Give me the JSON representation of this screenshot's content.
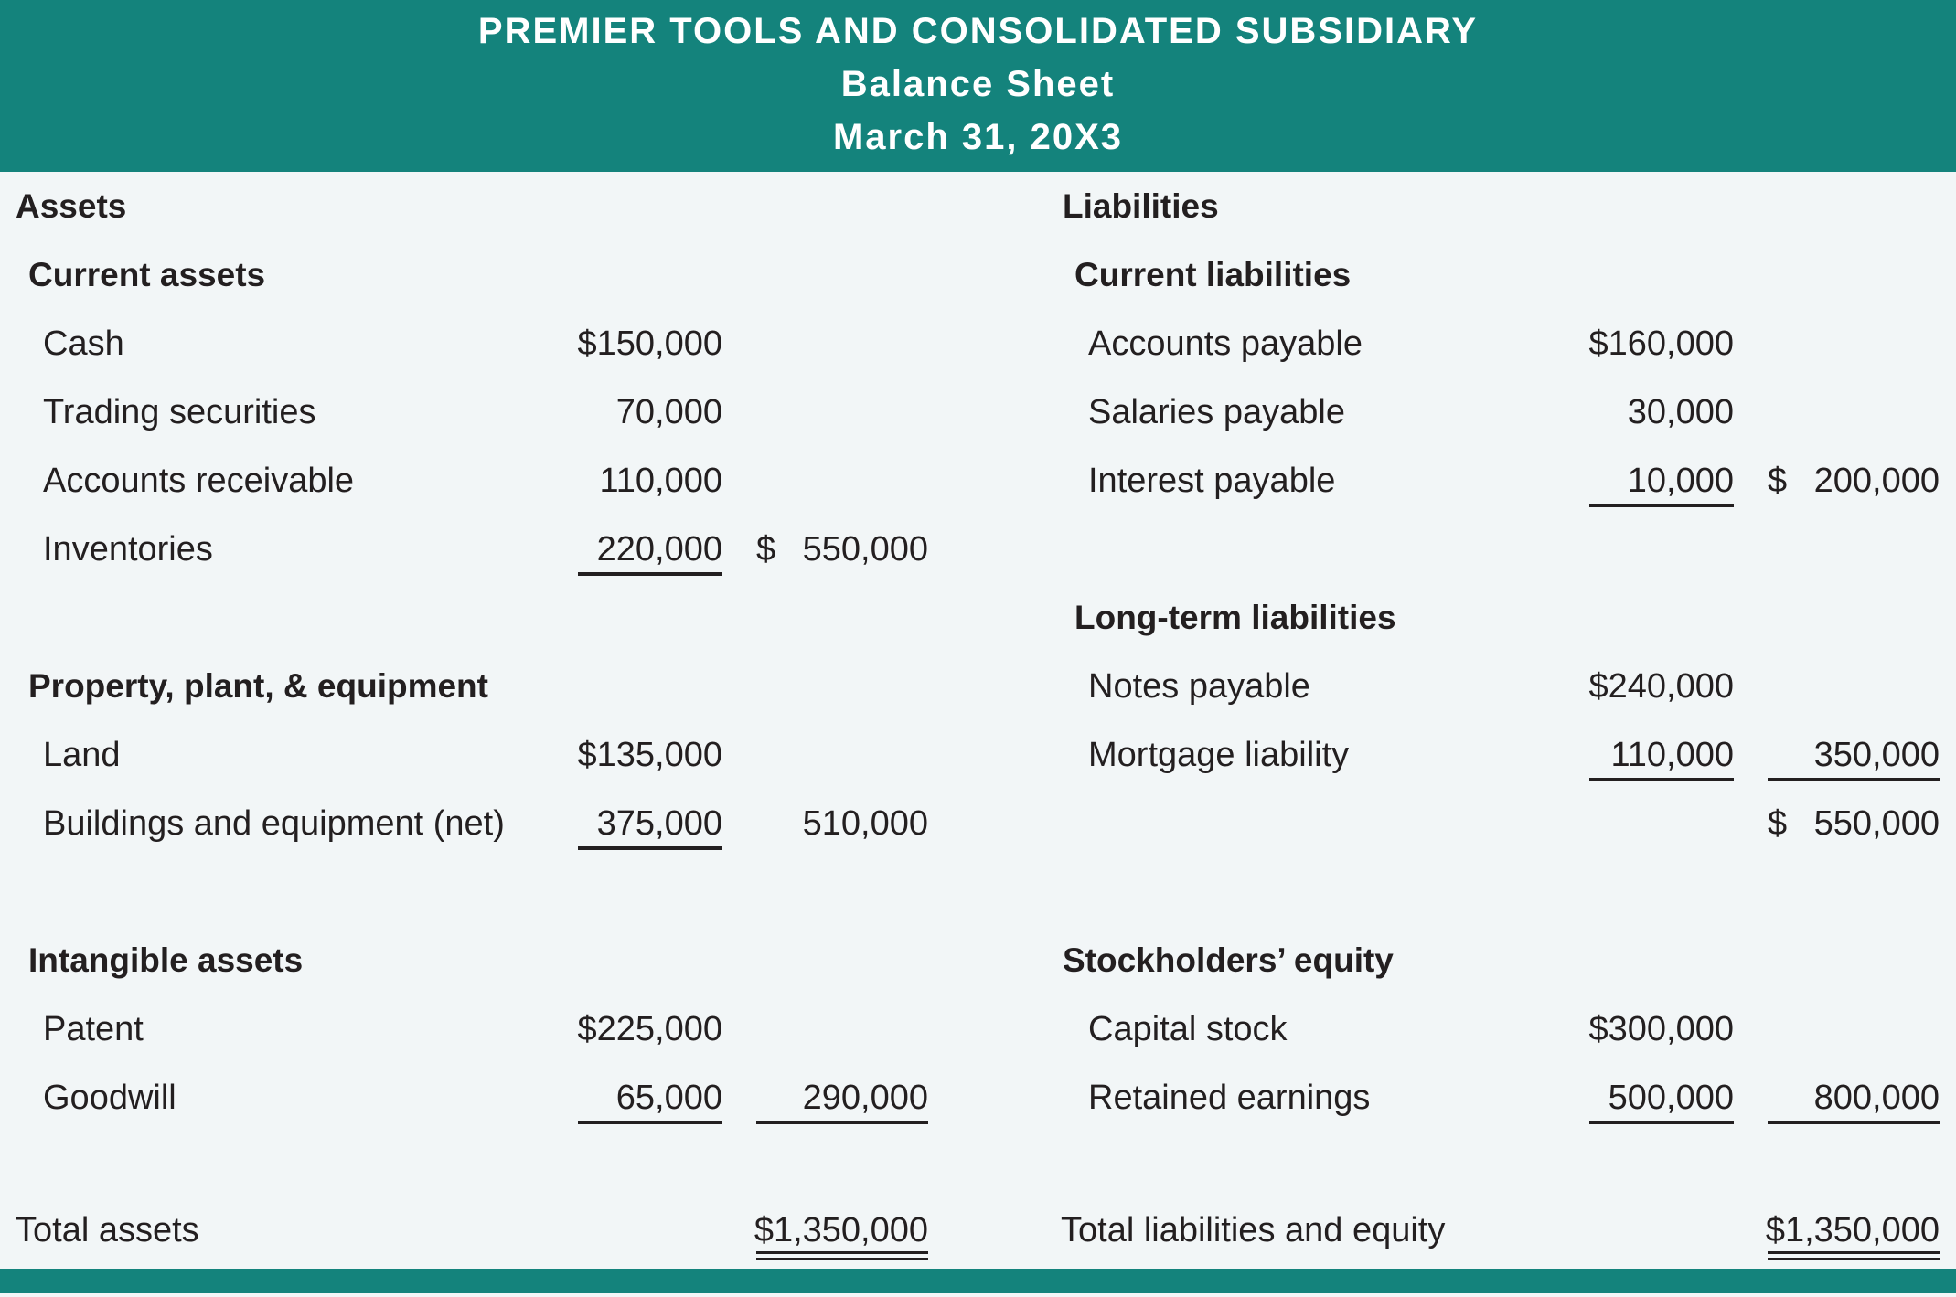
{
  "header": {
    "company": "PREMIER TOOLS AND CONSOLIDATED SUBSIDIARY",
    "statement": "Balance Sheet",
    "date": "March 31, 20X3"
  },
  "colors": {
    "accent": "#14837C",
    "background": "#F2F6F7",
    "text": "#231F20"
  },
  "assets": {
    "heading": "Assets",
    "current": {
      "heading": "Current assets",
      "items": [
        {
          "label": "Cash",
          "amount": "$150,000"
        },
        {
          "label": "Trading securities",
          "amount": "70,000"
        },
        {
          "label": "Accounts receivable",
          "amount": "110,000"
        },
        {
          "label": "Inventories",
          "amount": "220,000"
        }
      ],
      "total_sign": "$",
      "total": "550,000"
    },
    "ppe": {
      "heading": "Property, plant, & equipment",
      "items": [
        {
          "label": "Land",
          "amount": "$135,000"
        },
        {
          "label": "Buildings and equipment (net)",
          "amount": "375,000"
        }
      ],
      "total": "510,000"
    },
    "intangible": {
      "heading": "Intangible assets",
      "items": [
        {
          "label": "Patent",
          "amount": "$225,000"
        },
        {
          "label": "Goodwill",
          "amount": "65,000"
        }
      ],
      "total": "290,000"
    },
    "total_label": "Total assets",
    "total": "$1,350,000"
  },
  "liabilities": {
    "heading": "Liabilities",
    "current": {
      "heading": "Current liabilities",
      "items": [
        {
          "label": "Accounts payable",
          "amount": "$160,000"
        },
        {
          "label": "Salaries payable",
          "amount": "30,000"
        },
        {
          "label": "Interest payable",
          "amount": "10,000"
        }
      ],
      "total_sign": "$",
      "total": "200,000"
    },
    "long_term": {
      "heading": "Long-term liabilities",
      "items": [
        {
          "label": "Notes payable",
          "amount": "$240,000"
        },
        {
          "label": "Mortgage liability",
          "amount": "110,000"
        }
      ],
      "total": "350,000"
    },
    "total_sign": "$",
    "total": "550,000"
  },
  "equity": {
    "heading": "Stockholders’ equity",
    "items": [
      {
        "label": "Capital stock",
        "amount": "$300,000"
      },
      {
        "label": "Retained earnings",
        "amount": "500,000"
      }
    ],
    "total": "800,000"
  },
  "totals": {
    "liabilities_equity_label": "Total liabilities and equity",
    "liabilities_equity": "$1,350,000"
  }
}
